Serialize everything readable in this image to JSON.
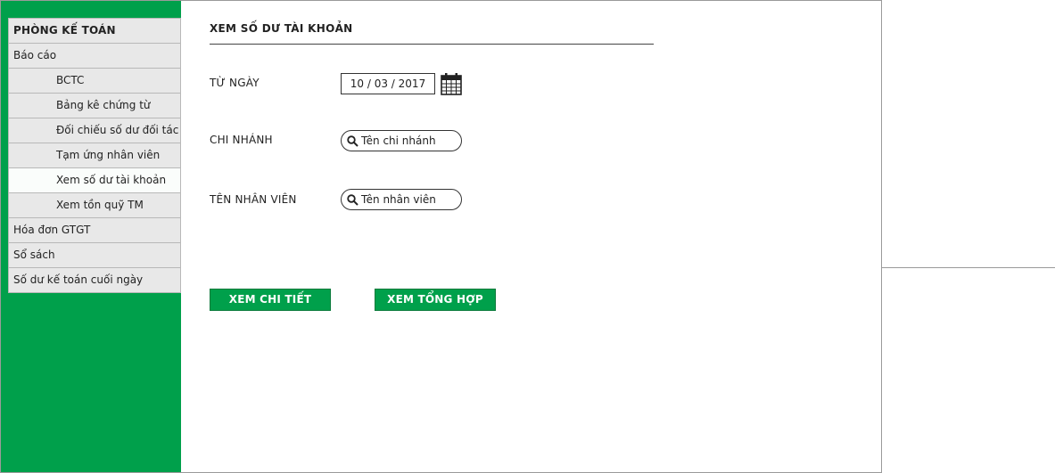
{
  "sidebar": {
    "header": "PHÒNG KẾ TOÁN",
    "items": [
      {
        "label": "Báo cáo"
      },
      {
        "label": "BCTC"
      },
      {
        "label": "Bảng kê chứng từ"
      },
      {
        "label": "Đối chiếu số dư đối tác"
      },
      {
        "label": "Tạm ứng nhân viên"
      },
      {
        "label": "Xem số dư tài khoản"
      },
      {
        "label": "Xem tồn quỹ TM"
      },
      {
        "label": "Hóa đơn GTGT"
      },
      {
        "label": "Sổ sách"
      },
      {
        "label": "Số dư kế toán cuối ngày"
      }
    ],
    "active_item": "Xem số dư tài khoản",
    "color": "#00a04b"
  },
  "main": {
    "title": "XEM SỐ DƯ TÀI KHOẢN",
    "from_date": {
      "label": "TỪ NGÀY",
      "value": "10 / 03 / 2017",
      "icon": "calendar-icon"
    },
    "branch": {
      "label": "CHI NHÁNH",
      "placeholder": "Tên chi nhánh",
      "icon": "search-icon"
    },
    "employee": {
      "label": "TÊN NHÂN VIÊN",
      "placeholder": "Tên nhân viên",
      "icon": "search-icon"
    },
    "buttons": {
      "detail": "XEM CHI TIẾT",
      "summary": "XEM TỔNG HỢP"
    },
    "accent_color": "#00a04b"
  }
}
